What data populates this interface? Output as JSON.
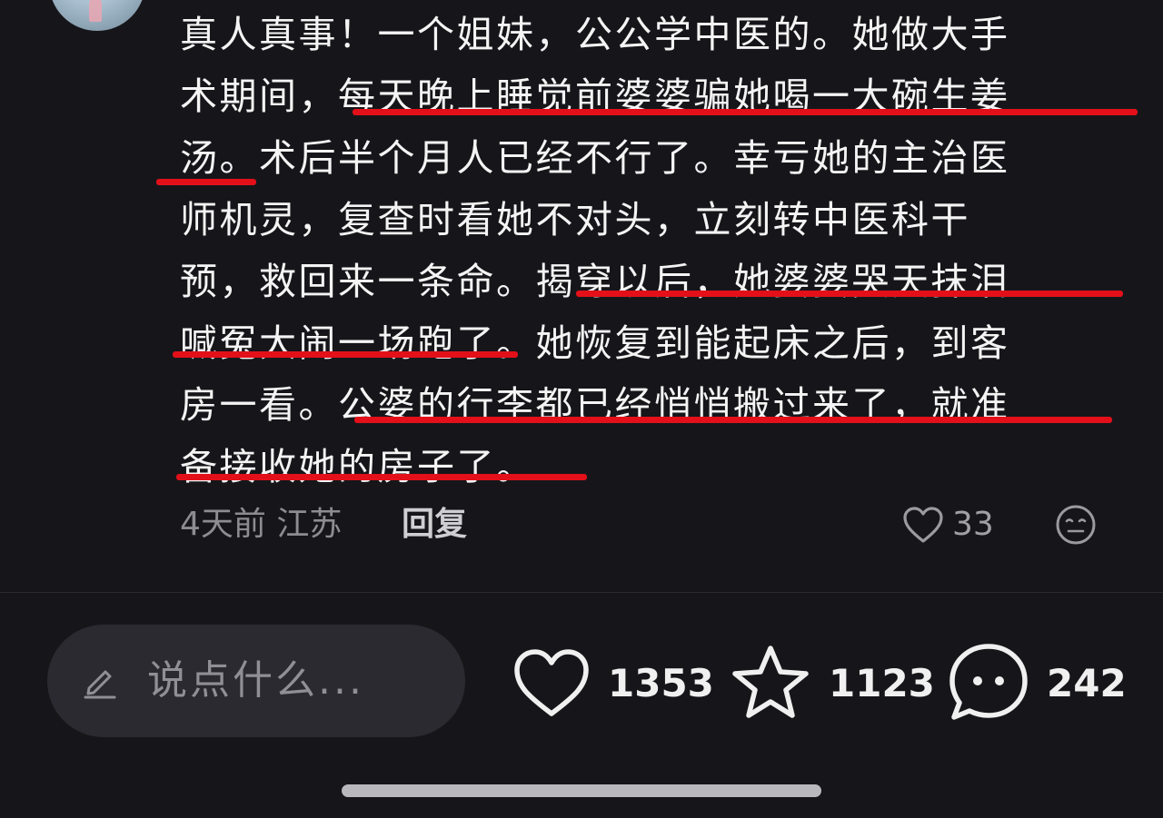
{
  "comment": {
    "lines": [
      {
        "pre": "真人真事！一个姐妹，公公学中医的。她做大手",
        "hl": "",
        "post": ""
      },
      {
        "pre": "术期间，",
        "hl": "每天晚上睡觉前婆婆骗她喝一大碗生姜",
        "post": ""
      },
      {
        "pre": "",
        "hl": "汤",
        "post": "。术后半个月人已经不行了。幸亏她的主治医"
      },
      {
        "pre": "师机灵，复查时看她不对头，立刻转中医科干",
        "hl": "",
        "post": ""
      },
      {
        "pre": "预，救回来一条命。",
        "hl": "揭穿以后，她婆婆哭天抹泪",
        "post": ""
      },
      {
        "pre": "",
        "hl": "喊冤大闹一场跑了",
        "post": "。她恢复到能起床之后，到客"
      },
      {
        "pre": "房一看。",
        "hl": "公婆的行李都已经悄悄搬过来了，就准",
        "post": ""
      },
      {
        "pre": "",
        "hl": "备接收她的房子了。",
        "post": ""
      }
    ],
    "time_location": "4天前 江苏",
    "reply_label": "回复",
    "like_count": "33",
    "highlight_color": "#e3101a"
  },
  "bottom_bar": {
    "input_placeholder": "说点什么...",
    "like_count": "1353",
    "favorite_count": "1123",
    "comment_count": "242"
  },
  "icons": {
    "avatar": "avatar",
    "comment_like": "heart-outline-icon",
    "emoji": "emoji-icon",
    "edit": "pencil-icon",
    "like": "heart-icon",
    "favorite": "star-icon",
    "comments": "speech-bubble-icon"
  }
}
